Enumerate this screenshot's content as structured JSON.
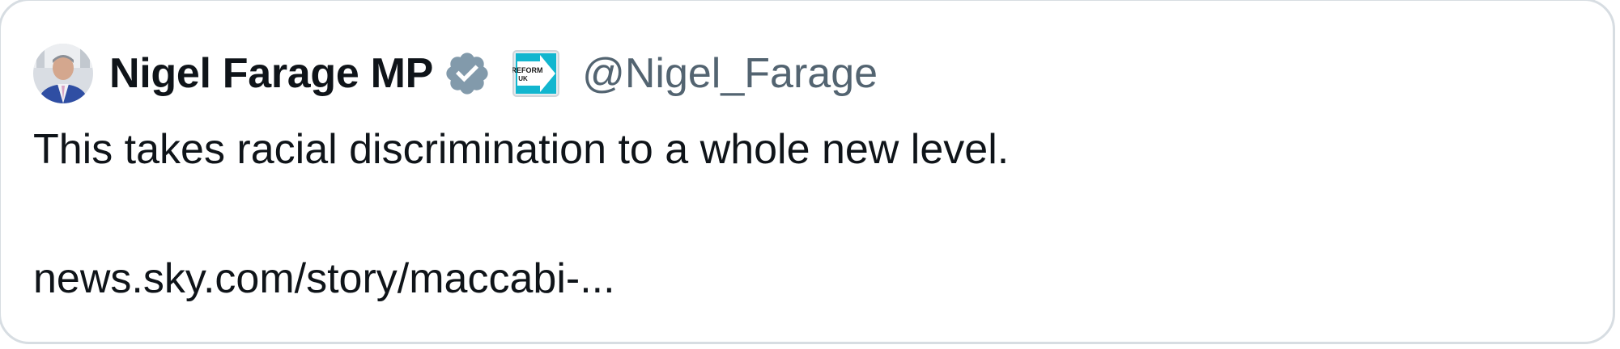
{
  "author": {
    "display_name": "Nigel Farage MP",
    "handle": "@Nigel_Farage",
    "avatar_icon": "profile-photo",
    "verified_icon": "verified-badge-icon",
    "verified_color": "#829aab",
    "affiliation_badge": {
      "icon": "reform-uk-logo",
      "text_line1": "REFORM",
      "text_line2": "UK",
      "color": "#12b6cf"
    }
  },
  "post": {
    "text": "This takes racial discrimination to a whole new level.",
    "link": "news.sky.com/story/maccabi-..."
  },
  "colors": {
    "text": "#0f1419",
    "secondary_text": "#536471",
    "border": "#d7dde2"
  }
}
